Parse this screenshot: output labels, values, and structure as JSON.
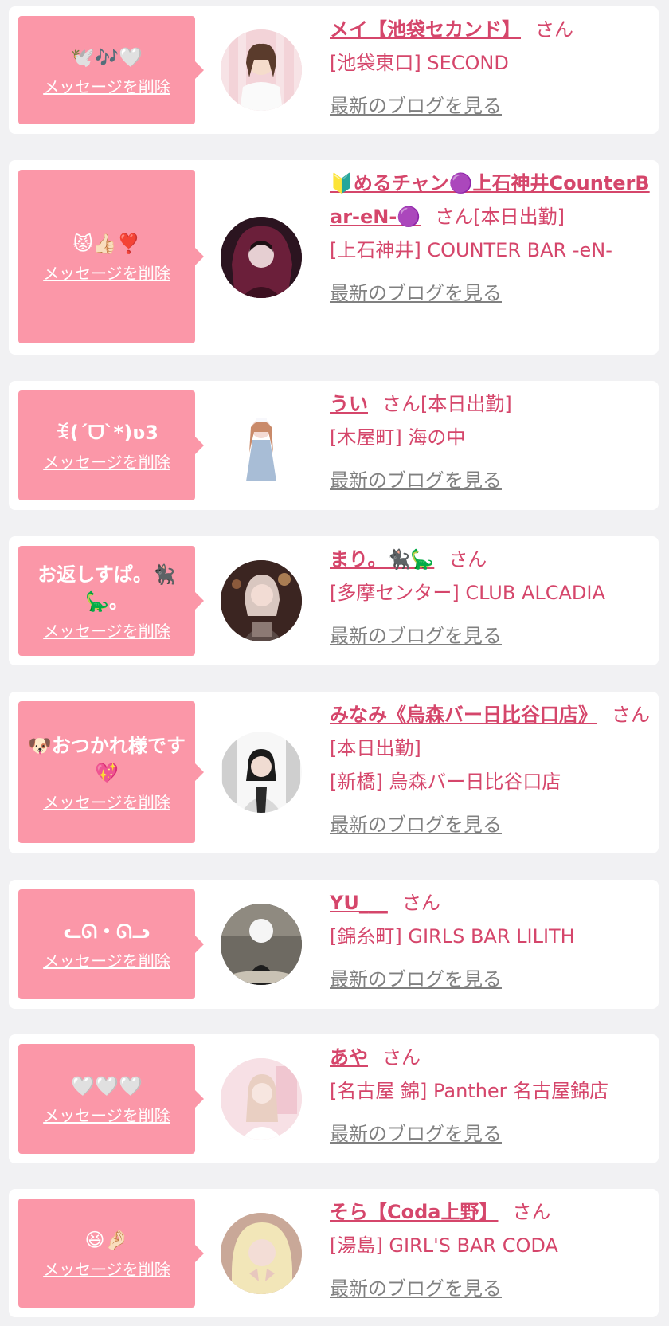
{
  "colors": {
    "accent": "#d5466b",
    "bubble": "#fb97a8",
    "muted": "#808080",
    "background": "#f1f1f3"
  },
  "delete_label": "メッセージを削除",
  "blog_label": "最新のブログを見る",
  "entries": [
    {
      "message": "🕊️🎶🤍",
      "name": "メイ【池袋セカンド】",
      "suffix": "さん",
      "shop": "[池袋東口] SECOND"
    },
    {
      "message": "😾👍🏻❣️",
      "name": "🔰めるチャン🟣上石神井CounterBar-eN-🟣",
      "suffix": "さん[本日出勤]",
      "shop": "[上石神井] COUNTER BAR -eN-"
    },
    {
      "message": "ꉂ(ˊᗜˋ*)ʋ3",
      "name": "うい",
      "suffix": "さん[本日出勤]",
      "shop": "[木屋町] 海の中"
    },
    {
      "message": "お返しすぱ。🐈‍⬛🦕。",
      "name": "まり。🐈‍⬛🦕",
      "suffix": "さん",
      "shop": "[多摩センター] CLUB ALCADIA"
    },
    {
      "message": "🐶おつかれ様です💖",
      "name": "みなみ《烏森バー日比谷口店》",
      "suffix": "さん[本日出勤]",
      "shop": "[新橋] 烏森バー日比谷口店"
    },
    {
      "message": "ᓚᘏ・ᘏᓗ",
      "name": "YU___",
      "suffix": "さん",
      "shop": "[錦糸町] GIRLS BAR LILITH"
    },
    {
      "message": "🤍🤍🤍",
      "name": "あや",
      "suffix": "さん",
      "shop": "[名古屋 錦] Panther 名古屋錦店"
    },
    {
      "message": "😆🤌🏻",
      "name": "そら【Coda上野】",
      "suffix": "さん",
      "shop": "[湯島] GIRL'S BAR CODA"
    }
  ]
}
